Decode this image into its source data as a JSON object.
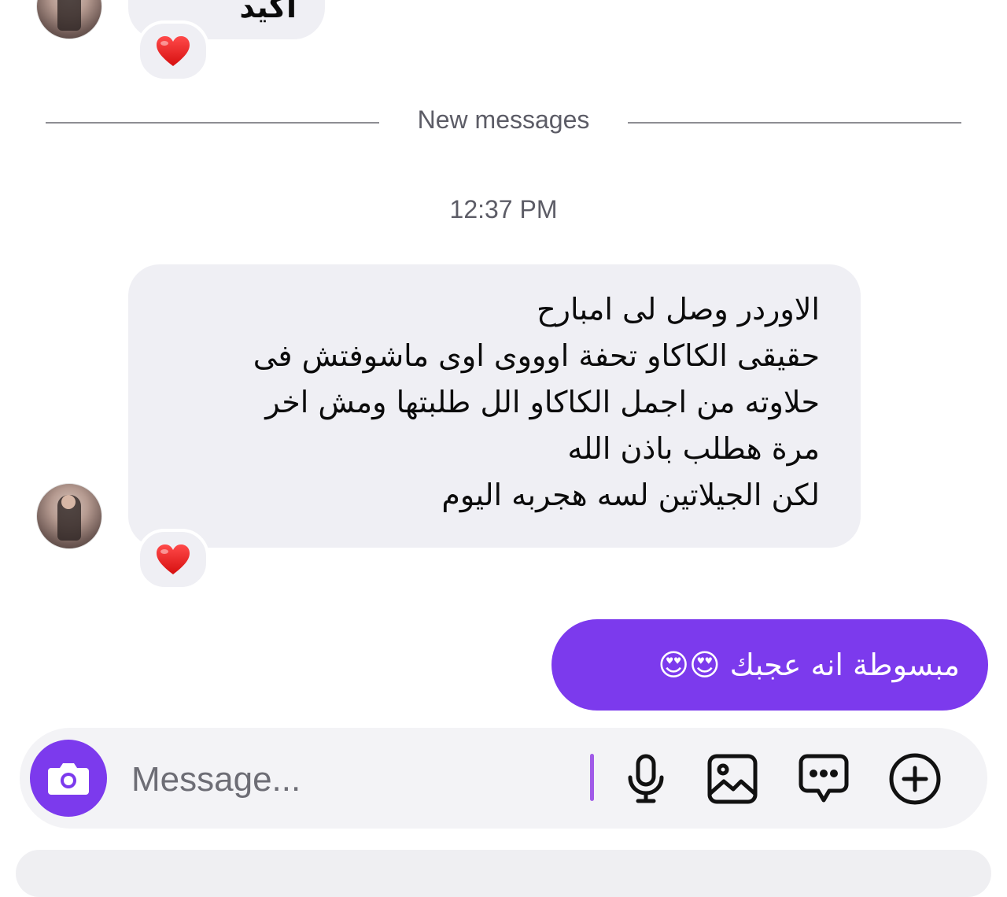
{
  "colors": {
    "accent": "#7c3aed",
    "incoming_bubble": "#efeff4",
    "muted_text": "#5c5c66"
  },
  "messages": {
    "prev_partial_text": "اكيد هيعجبك",
    "reaction_emoji": "❤️",
    "divider_label": "New messages",
    "timestamp": "12:37 PM",
    "incoming_lines": [
      "الاوردر وصل لى امبارح",
      "حقيقى الكاكاو تحفة اوووى اوى ماشوفتش فى",
      "حلاوته من اجمل الكاكاو الل طلبتها ومش اخر",
      "مرة هطلب باذن الله",
      "لكن الجيلاتين لسه هجربه اليوم"
    ],
    "outgoing_text": "مبسوطة انه عجبك 😍😍"
  },
  "composer": {
    "placeholder": "Message...",
    "camera_icon": "camera-icon",
    "tools": [
      "microphone-icon",
      "image-icon",
      "sticker-chat-icon",
      "plus-icon"
    ]
  }
}
